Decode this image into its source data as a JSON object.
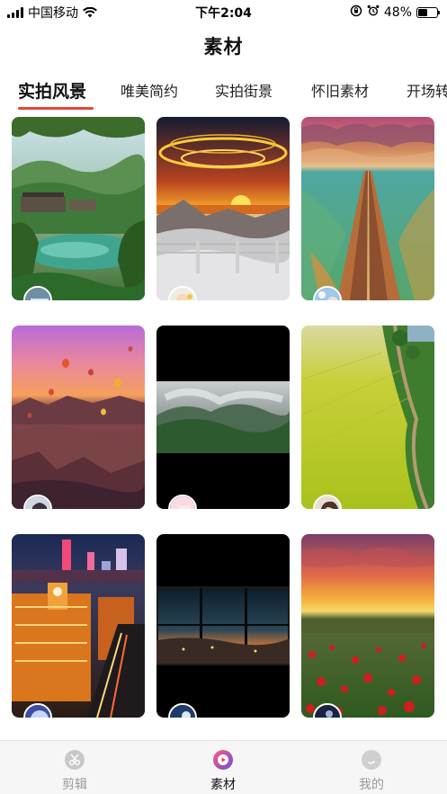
{
  "status_bar": {
    "carrier": "中国移动",
    "time": "下午2:04",
    "battery": "48%",
    "battery_level": 0.48
  },
  "header": {
    "title": "素材"
  },
  "tabs": [
    {
      "label": "实拍风景",
      "active": true
    },
    {
      "label": "唯美简约",
      "active": false
    },
    {
      "label": "实拍街景",
      "active": false
    },
    {
      "label": "怀旧素材",
      "active": false
    },
    {
      "label": "开场转",
      "active": false
    }
  ],
  "accent_color": "#e8443a",
  "cards": [
    {
      "subject": "green valley village with lake",
      "icon": "landscape-thumbnail"
    },
    {
      "subject": "sunset over sea of clouds",
      "icon": "landscape-thumbnail"
    },
    {
      "subject": "long road through green flats",
      "icon": "landscape-thumbnail"
    },
    {
      "subject": "hot air balloons over canyon",
      "icon": "landscape-thumbnail"
    },
    {
      "subject": "misty mountains letterbox",
      "icon": "landscape-thumbnail"
    },
    {
      "subject": "yellow rapeseed field",
      "icon": "landscape-thumbnail"
    },
    {
      "subject": "city night with clock tower",
      "icon": "landscape-thumbnail"
    },
    {
      "subject": "window view at dusk letterbox",
      "icon": "landscape-thumbnail"
    },
    {
      "subject": "red poppy field at sunset",
      "icon": "landscape-thumbnail"
    }
  ],
  "bottom_nav": [
    {
      "label": "剪辑",
      "icon": "scissors-icon",
      "active": false
    },
    {
      "label": "素材",
      "icon": "material-play-icon",
      "active": true
    },
    {
      "label": "我的",
      "icon": "profile-icon",
      "active": false
    }
  ]
}
